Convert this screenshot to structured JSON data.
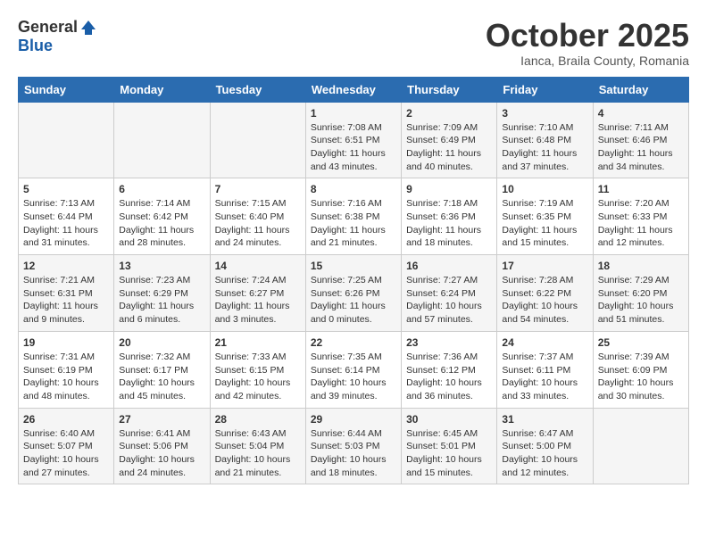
{
  "logo": {
    "general": "General",
    "blue": "Blue"
  },
  "title": "October 2025",
  "subtitle": "Ianca, Braila County, Romania",
  "days_of_week": [
    "Sunday",
    "Monday",
    "Tuesday",
    "Wednesday",
    "Thursday",
    "Friday",
    "Saturday"
  ],
  "weeks": [
    {
      "days": [
        {
          "num": "",
          "info": ""
        },
        {
          "num": "",
          "info": ""
        },
        {
          "num": "",
          "info": ""
        },
        {
          "num": "1",
          "info": "Sunrise: 7:08 AM\nSunset: 6:51 PM\nDaylight: 11 hours\nand 43 minutes."
        },
        {
          "num": "2",
          "info": "Sunrise: 7:09 AM\nSunset: 6:49 PM\nDaylight: 11 hours\nand 40 minutes."
        },
        {
          "num": "3",
          "info": "Sunrise: 7:10 AM\nSunset: 6:48 PM\nDaylight: 11 hours\nand 37 minutes."
        },
        {
          "num": "4",
          "info": "Sunrise: 7:11 AM\nSunset: 6:46 PM\nDaylight: 11 hours\nand 34 minutes."
        }
      ]
    },
    {
      "days": [
        {
          "num": "5",
          "info": "Sunrise: 7:13 AM\nSunset: 6:44 PM\nDaylight: 11 hours\nand 31 minutes."
        },
        {
          "num": "6",
          "info": "Sunrise: 7:14 AM\nSunset: 6:42 PM\nDaylight: 11 hours\nand 28 minutes."
        },
        {
          "num": "7",
          "info": "Sunrise: 7:15 AM\nSunset: 6:40 PM\nDaylight: 11 hours\nand 24 minutes."
        },
        {
          "num": "8",
          "info": "Sunrise: 7:16 AM\nSunset: 6:38 PM\nDaylight: 11 hours\nand 21 minutes."
        },
        {
          "num": "9",
          "info": "Sunrise: 7:18 AM\nSunset: 6:36 PM\nDaylight: 11 hours\nand 18 minutes."
        },
        {
          "num": "10",
          "info": "Sunrise: 7:19 AM\nSunset: 6:35 PM\nDaylight: 11 hours\nand 15 minutes."
        },
        {
          "num": "11",
          "info": "Sunrise: 7:20 AM\nSunset: 6:33 PM\nDaylight: 11 hours\nand 12 minutes."
        }
      ]
    },
    {
      "days": [
        {
          "num": "12",
          "info": "Sunrise: 7:21 AM\nSunset: 6:31 PM\nDaylight: 11 hours\nand 9 minutes."
        },
        {
          "num": "13",
          "info": "Sunrise: 7:23 AM\nSunset: 6:29 PM\nDaylight: 11 hours\nand 6 minutes."
        },
        {
          "num": "14",
          "info": "Sunrise: 7:24 AM\nSunset: 6:27 PM\nDaylight: 11 hours\nand 3 minutes."
        },
        {
          "num": "15",
          "info": "Sunrise: 7:25 AM\nSunset: 6:26 PM\nDaylight: 11 hours\nand 0 minutes."
        },
        {
          "num": "16",
          "info": "Sunrise: 7:27 AM\nSunset: 6:24 PM\nDaylight: 10 hours\nand 57 minutes."
        },
        {
          "num": "17",
          "info": "Sunrise: 7:28 AM\nSunset: 6:22 PM\nDaylight: 10 hours\nand 54 minutes."
        },
        {
          "num": "18",
          "info": "Sunrise: 7:29 AM\nSunset: 6:20 PM\nDaylight: 10 hours\nand 51 minutes."
        }
      ]
    },
    {
      "days": [
        {
          "num": "19",
          "info": "Sunrise: 7:31 AM\nSunset: 6:19 PM\nDaylight: 10 hours\nand 48 minutes."
        },
        {
          "num": "20",
          "info": "Sunrise: 7:32 AM\nSunset: 6:17 PM\nDaylight: 10 hours\nand 45 minutes."
        },
        {
          "num": "21",
          "info": "Sunrise: 7:33 AM\nSunset: 6:15 PM\nDaylight: 10 hours\nand 42 minutes."
        },
        {
          "num": "22",
          "info": "Sunrise: 7:35 AM\nSunset: 6:14 PM\nDaylight: 10 hours\nand 39 minutes."
        },
        {
          "num": "23",
          "info": "Sunrise: 7:36 AM\nSunset: 6:12 PM\nDaylight: 10 hours\nand 36 minutes."
        },
        {
          "num": "24",
          "info": "Sunrise: 7:37 AM\nSunset: 6:11 PM\nDaylight: 10 hours\nand 33 minutes."
        },
        {
          "num": "25",
          "info": "Sunrise: 7:39 AM\nSunset: 6:09 PM\nDaylight: 10 hours\nand 30 minutes."
        }
      ]
    },
    {
      "days": [
        {
          "num": "26",
          "info": "Sunrise: 6:40 AM\nSunset: 5:07 PM\nDaylight: 10 hours\nand 27 minutes."
        },
        {
          "num": "27",
          "info": "Sunrise: 6:41 AM\nSunset: 5:06 PM\nDaylight: 10 hours\nand 24 minutes."
        },
        {
          "num": "28",
          "info": "Sunrise: 6:43 AM\nSunset: 5:04 PM\nDaylight: 10 hours\nand 21 minutes."
        },
        {
          "num": "29",
          "info": "Sunrise: 6:44 AM\nSunset: 5:03 PM\nDaylight: 10 hours\nand 18 minutes."
        },
        {
          "num": "30",
          "info": "Sunrise: 6:45 AM\nSunset: 5:01 PM\nDaylight: 10 hours\nand 15 minutes."
        },
        {
          "num": "31",
          "info": "Sunrise: 6:47 AM\nSunset: 5:00 PM\nDaylight: 10 hours\nand 12 minutes."
        },
        {
          "num": "",
          "info": ""
        }
      ]
    }
  ]
}
